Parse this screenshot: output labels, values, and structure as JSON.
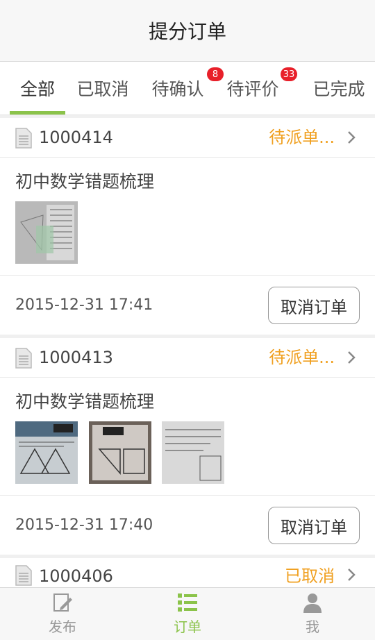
{
  "header": {
    "title": "提分订单"
  },
  "tabs": [
    {
      "label": "全部",
      "active": true
    },
    {
      "label": "已取消"
    },
    {
      "label": "待确认",
      "badge": "8"
    },
    {
      "label": "待评价",
      "badge": "33"
    },
    {
      "label": "已完成"
    }
  ],
  "orders": [
    {
      "number": "1000414",
      "status": "待派单...",
      "title": "初中数学错题梳理",
      "datetime": "2015-12-31 17:41",
      "cancel_label": "取消订单"
    },
    {
      "number": "1000413",
      "status": "待派单...",
      "title": "初中数学错题梳理",
      "datetime": "2015-12-31 17:40",
      "cancel_label": "取消订单"
    },
    {
      "number": "1000406",
      "status": "已取消"
    }
  ],
  "bottom_nav": [
    {
      "label": "发布",
      "icon": "publish-icon"
    },
    {
      "label": "订单",
      "icon": "list-icon",
      "active": true
    },
    {
      "label": "我",
      "icon": "user-icon"
    }
  ],
  "colors": {
    "accent": "#8bc34a",
    "status": "#f0a020",
    "badge": "#e8202a"
  }
}
